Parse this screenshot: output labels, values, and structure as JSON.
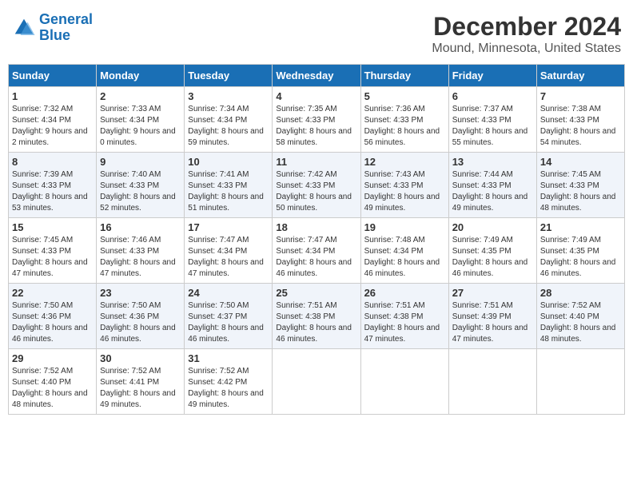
{
  "header": {
    "logo_line1": "General",
    "logo_line2": "Blue",
    "main_title": "December 2024",
    "subtitle": "Mound, Minnesota, United States"
  },
  "calendar": {
    "days_of_week": [
      "Sunday",
      "Monday",
      "Tuesday",
      "Wednesday",
      "Thursday",
      "Friday",
      "Saturday"
    ],
    "weeks": [
      [
        {
          "day": "1",
          "info": "Sunrise: 7:32 AM\nSunset: 4:34 PM\nDaylight: 9 hours and 2 minutes."
        },
        {
          "day": "2",
          "info": "Sunrise: 7:33 AM\nSunset: 4:34 PM\nDaylight: 9 hours and 0 minutes."
        },
        {
          "day": "3",
          "info": "Sunrise: 7:34 AM\nSunset: 4:34 PM\nDaylight: 8 hours and 59 minutes."
        },
        {
          "day": "4",
          "info": "Sunrise: 7:35 AM\nSunset: 4:33 PM\nDaylight: 8 hours and 58 minutes."
        },
        {
          "day": "5",
          "info": "Sunrise: 7:36 AM\nSunset: 4:33 PM\nDaylight: 8 hours and 56 minutes."
        },
        {
          "day": "6",
          "info": "Sunrise: 7:37 AM\nSunset: 4:33 PM\nDaylight: 8 hours and 55 minutes."
        },
        {
          "day": "7",
          "info": "Sunrise: 7:38 AM\nSunset: 4:33 PM\nDaylight: 8 hours and 54 minutes."
        }
      ],
      [
        {
          "day": "8",
          "info": "Sunrise: 7:39 AM\nSunset: 4:33 PM\nDaylight: 8 hours and 53 minutes."
        },
        {
          "day": "9",
          "info": "Sunrise: 7:40 AM\nSunset: 4:33 PM\nDaylight: 8 hours and 52 minutes."
        },
        {
          "day": "10",
          "info": "Sunrise: 7:41 AM\nSunset: 4:33 PM\nDaylight: 8 hours and 51 minutes."
        },
        {
          "day": "11",
          "info": "Sunrise: 7:42 AM\nSunset: 4:33 PM\nDaylight: 8 hours and 50 minutes."
        },
        {
          "day": "12",
          "info": "Sunrise: 7:43 AM\nSunset: 4:33 PM\nDaylight: 8 hours and 49 minutes."
        },
        {
          "day": "13",
          "info": "Sunrise: 7:44 AM\nSunset: 4:33 PM\nDaylight: 8 hours and 49 minutes."
        },
        {
          "day": "14",
          "info": "Sunrise: 7:45 AM\nSunset: 4:33 PM\nDaylight: 8 hours and 48 minutes."
        }
      ],
      [
        {
          "day": "15",
          "info": "Sunrise: 7:45 AM\nSunset: 4:33 PM\nDaylight: 8 hours and 47 minutes."
        },
        {
          "day": "16",
          "info": "Sunrise: 7:46 AM\nSunset: 4:33 PM\nDaylight: 8 hours and 47 minutes."
        },
        {
          "day": "17",
          "info": "Sunrise: 7:47 AM\nSunset: 4:34 PM\nDaylight: 8 hours and 47 minutes."
        },
        {
          "day": "18",
          "info": "Sunrise: 7:47 AM\nSunset: 4:34 PM\nDaylight: 8 hours and 46 minutes."
        },
        {
          "day": "19",
          "info": "Sunrise: 7:48 AM\nSunset: 4:34 PM\nDaylight: 8 hours and 46 minutes."
        },
        {
          "day": "20",
          "info": "Sunrise: 7:49 AM\nSunset: 4:35 PM\nDaylight: 8 hours and 46 minutes."
        },
        {
          "day": "21",
          "info": "Sunrise: 7:49 AM\nSunset: 4:35 PM\nDaylight: 8 hours and 46 minutes."
        }
      ],
      [
        {
          "day": "22",
          "info": "Sunrise: 7:50 AM\nSunset: 4:36 PM\nDaylight: 8 hours and 46 minutes."
        },
        {
          "day": "23",
          "info": "Sunrise: 7:50 AM\nSunset: 4:36 PM\nDaylight: 8 hours and 46 minutes."
        },
        {
          "day": "24",
          "info": "Sunrise: 7:50 AM\nSunset: 4:37 PM\nDaylight: 8 hours and 46 minutes."
        },
        {
          "day": "25",
          "info": "Sunrise: 7:51 AM\nSunset: 4:38 PM\nDaylight: 8 hours and 46 minutes."
        },
        {
          "day": "26",
          "info": "Sunrise: 7:51 AM\nSunset: 4:38 PM\nDaylight: 8 hours and 47 minutes."
        },
        {
          "day": "27",
          "info": "Sunrise: 7:51 AM\nSunset: 4:39 PM\nDaylight: 8 hours and 47 minutes."
        },
        {
          "day": "28",
          "info": "Sunrise: 7:52 AM\nSunset: 4:40 PM\nDaylight: 8 hours and 48 minutes."
        }
      ],
      [
        {
          "day": "29",
          "info": "Sunrise: 7:52 AM\nSunset: 4:40 PM\nDaylight: 8 hours and 48 minutes."
        },
        {
          "day": "30",
          "info": "Sunrise: 7:52 AM\nSunset: 4:41 PM\nDaylight: 8 hours and 49 minutes."
        },
        {
          "day": "31",
          "info": "Sunrise: 7:52 AM\nSunset: 4:42 PM\nDaylight: 8 hours and 49 minutes."
        },
        null,
        null,
        null,
        null
      ]
    ]
  }
}
